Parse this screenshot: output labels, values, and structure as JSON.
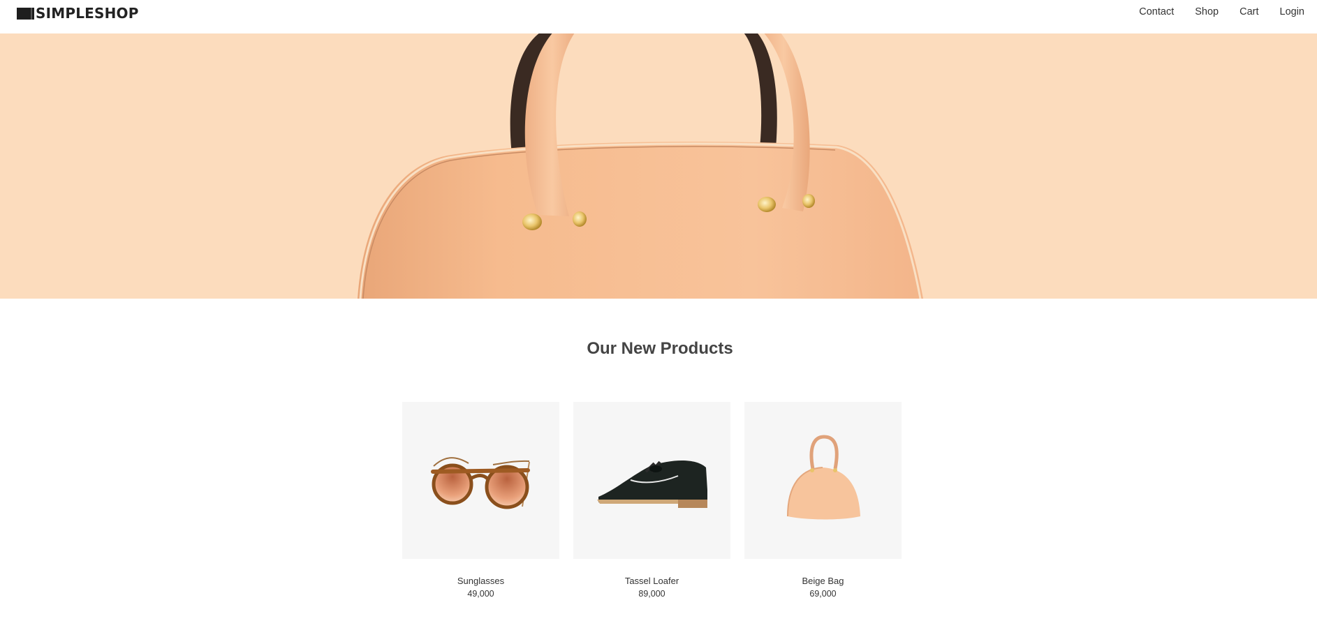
{
  "header": {
    "logo_text": "SIMPLESHOP",
    "nav": [
      {
        "label": "Contact"
      },
      {
        "label": "Shop"
      },
      {
        "label": "Cart"
      },
      {
        "label": "Login"
      }
    ]
  },
  "hero": {
    "image": "handbag-banner",
    "background_color": "#fcdcbd"
  },
  "section": {
    "title": "Our New Products"
  },
  "products": [
    {
      "name": "Sunglasses",
      "price": "49,000",
      "image": "sunglasses"
    },
    {
      "name": "Tassel Loafer",
      "price": "89,000",
      "image": "tassel-loafer"
    },
    {
      "name": "Beige Bag",
      "price": "69,000",
      "image": "beige-bag"
    }
  ],
  "colors": {
    "text": "#333333",
    "card_background": "#f6f6f6",
    "hero_background": "#fcdcbd"
  }
}
